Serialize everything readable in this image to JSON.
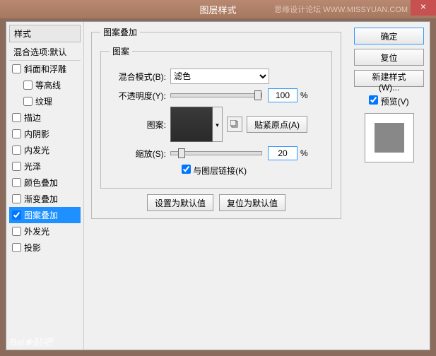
{
  "window": {
    "title": "图层样式",
    "watermark": "思缘设计论坛  WWW.MISSYUAN.COM"
  },
  "left": {
    "styles_header": "样式",
    "blend_header": "混合选项:默认",
    "items": [
      {
        "label": "斜面和浮雕",
        "checked": false,
        "indent": false
      },
      {
        "label": "等高线",
        "checked": false,
        "indent": true
      },
      {
        "label": "纹理",
        "checked": false,
        "indent": true
      },
      {
        "label": "描边",
        "checked": false,
        "indent": false
      },
      {
        "label": "内阴影",
        "checked": false,
        "indent": false
      },
      {
        "label": "内发光",
        "checked": false,
        "indent": false
      },
      {
        "label": "光泽",
        "checked": false,
        "indent": false
      },
      {
        "label": "颜色叠加",
        "checked": false,
        "indent": false
      },
      {
        "label": "渐变叠加",
        "checked": false,
        "indent": false
      },
      {
        "label": "图案叠加",
        "checked": true,
        "indent": false,
        "selected": true
      },
      {
        "label": "外发光",
        "checked": false,
        "indent": false
      },
      {
        "label": "投影",
        "checked": false,
        "indent": false
      }
    ]
  },
  "center": {
    "group_title": "图案叠加",
    "pattern_title": "图案",
    "blend_mode_label": "混合模式(B):",
    "blend_mode_value": "滤色",
    "opacity_label": "不透明度(Y):",
    "opacity_value": "100",
    "percent": "%",
    "pattern_label": "图案:",
    "snap_origin": "贴紧原点(A)",
    "scale_label": "缩放(S):",
    "scale_value": "20",
    "link_layer": "与图层链接(K)",
    "set_default": "设置为默认值",
    "reset_default": "复位为默认值"
  },
  "right": {
    "ok": "确定",
    "reset": "复位",
    "new_style": "新建样式(W)...",
    "preview": "预览(V)"
  },
  "footer": {
    "logo": "Bai❀贴吧"
  }
}
